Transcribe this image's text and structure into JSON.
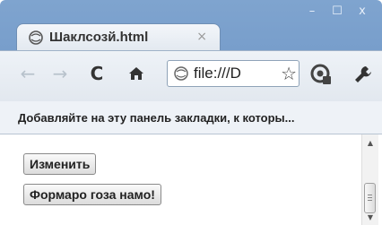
{
  "window": {
    "controls": {
      "minimize": "–",
      "maximize": "☐",
      "close": "x"
    }
  },
  "tab": {
    "title": "Шаклсозй.html",
    "close": "×"
  },
  "toolbar": {
    "back": "←",
    "forward": "→",
    "reload": "C",
    "home": "🏠",
    "address": "file:///D",
    "star": "☆"
  },
  "bookmarks_bar": {
    "hint": "Добавляйте на эту панель закладки, к которы..."
  },
  "page": {
    "buttons": [
      {
        "label": "Изменить"
      },
      {
        "label": "Формаро гоза намо!"
      }
    ]
  },
  "scrollbar": {
    "up": "▲",
    "down": "▼"
  }
}
